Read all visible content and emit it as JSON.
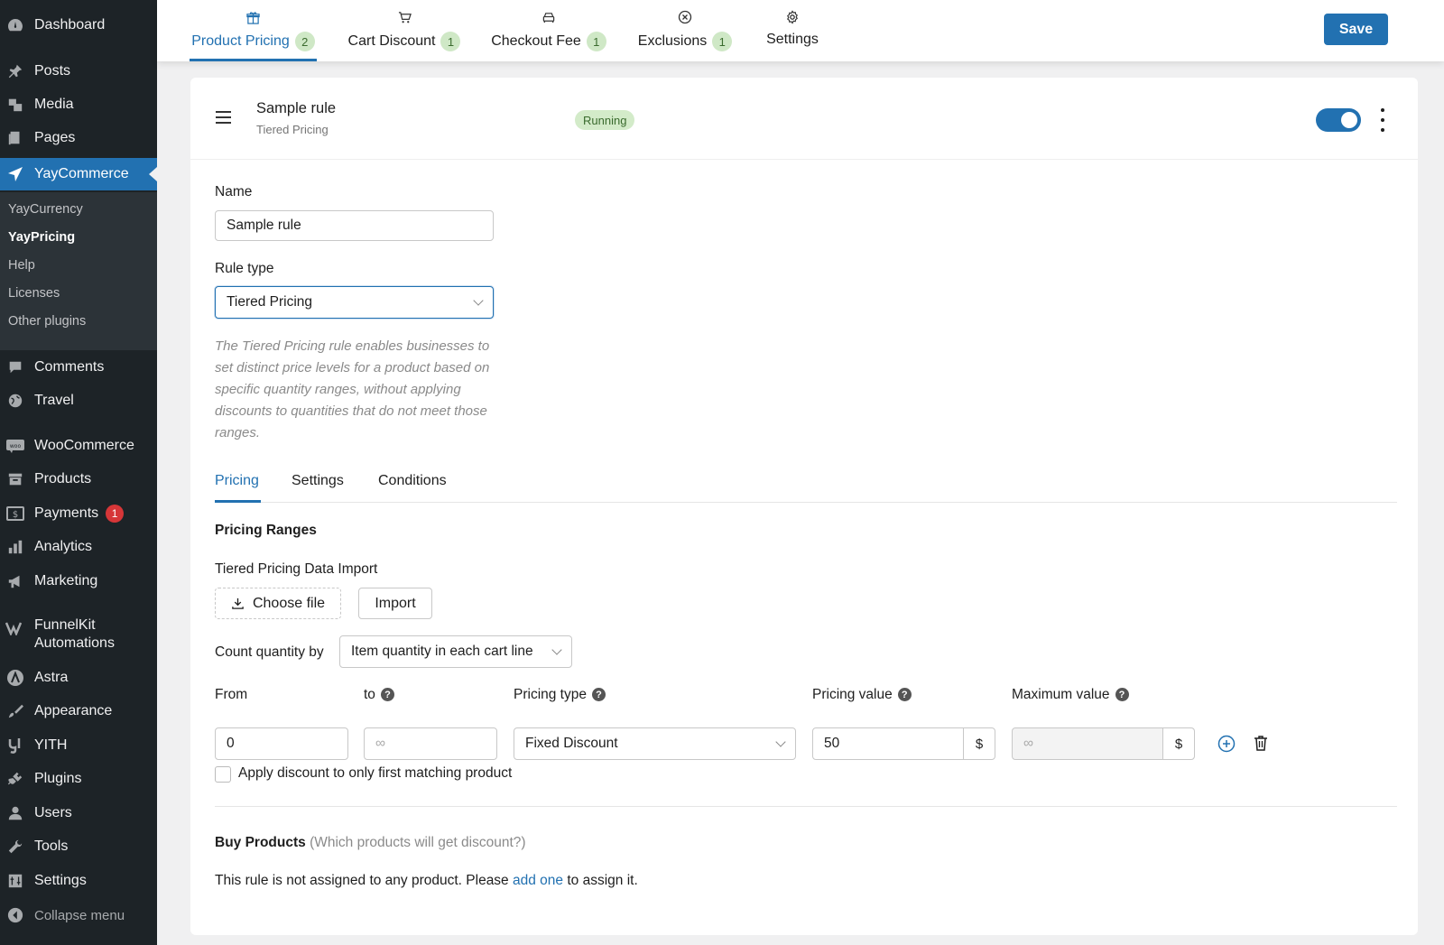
{
  "sidebar": {
    "items": [
      {
        "label": "Dashboard",
        "icon": "dashboard-icon"
      },
      {
        "label": "Posts",
        "icon": "pin-icon"
      },
      {
        "label": "Media",
        "icon": "media-icon"
      },
      {
        "label": "Pages",
        "icon": "pages-icon"
      },
      {
        "label": "YayCommerce",
        "icon": "yaycommerce-icon"
      },
      {
        "label": "Comments",
        "icon": "comment-icon"
      },
      {
        "label": "Travel",
        "icon": "globe-icon"
      },
      {
        "label": "WooCommerce",
        "icon": "woocommerce-icon"
      },
      {
        "label": "Products",
        "icon": "archive-icon"
      },
      {
        "label": "Payments",
        "icon": "payments-icon",
        "badge": "1"
      },
      {
        "label": "Analytics",
        "icon": "bar-chart-icon"
      },
      {
        "label": "Marketing",
        "icon": "megaphone-icon"
      },
      {
        "label": "FunnelKit",
        "label2": "Automations",
        "icon": "funnelkit-icon"
      },
      {
        "label": "Astra",
        "icon": "astra-icon"
      },
      {
        "label": "Appearance",
        "icon": "brush-icon"
      },
      {
        "label": "YITH",
        "icon": "yith-icon"
      },
      {
        "label": "Plugins",
        "icon": "plug-icon"
      },
      {
        "label": "Users",
        "icon": "user-icon"
      },
      {
        "label": "Tools",
        "icon": "wrench-icon"
      },
      {
        "label": "Settings",
        "icon": "settings-icon"
      },
      {
        "label": "Collapse menu",
        "icon": "collapse-icon"
      }
    ],
    "submenu": [
      "YayCurrency",
      "YayPricing",
      "Help",
      "Licenses",
      "Other plugins"
    ]
  },
  "topbar": {
    "tabs": [
      {
        "label": "Product Pricing",
        "badge": "2",
        "icon": "gift-icon"
      },
      {
        "label": "Cart Discount",
        "badge": "1",
        "icon": "cart-icon"
      },
      {
        "label": "Checkout Fee",
        "badge": "1",
        "icon": "car-icon"
      },
      {
        "label": "Exclusions",
        "badge": "1",
        "icon": "x-circle-icon"
      },
      {
        "label": "Settings",
        "badge": "",
        "icon": "gear-icon"
      }
    ],
    "save_label": "Save"
  },
  "rule": {
    "title": "Sample rule",
    "subtitle": "Tiered Pricing",
    "status": "Running",
    "enabled": true
  },
  "form": {
    "name_label": "Name",
    "name_value": "Sample rule",
    "rule_type_label": "Rule type",
    "rule_type_value": "Tiered Pricing",
    "description": "The Tiered Pricing rule enables businesses to set distinct price levels for a product based on specific quantity ranges, without applying discounts to quantities that do not meet those ranges."
  },
  "subtabs": [
    "Pricing",
    "Settings",
    "Conditions"
  ],
  "pricing": {
    "section_title": "Pricing Ranges",
    "import_label": "Tiered Pricing Data Import",
    "choose_file_label": "Choose file",
    "import_button": "Import",
    "count_by_label": "Count quantity by",
    "count_by_value": "Item quantity in each cart line",
    "from_label": "From",
    "to_label": "to",
    "pricing_type_label": "Pricing type",
    "pricing_value_label": "Pricing value",
    "max_value_label": "Maximum value",
    "row": {
      "from": "0",
      "to_placeholder": "∞",
      "pricing_type": "Fixed Discount",
      "pricing_value": "50",
      "currency": "$",
      "max_placeholder": "∞"
    },
    "apply_first_label": "Apply discount to only first matching product"
  },
  "buy_products": {
    "title": "Buy Products",
    "hint": "(Which products will get discount?)",
    "text_before": "This rule is not assigned to any product. Please",
    "link": "add one",
    "text_after": "to assign it."
  }
}
